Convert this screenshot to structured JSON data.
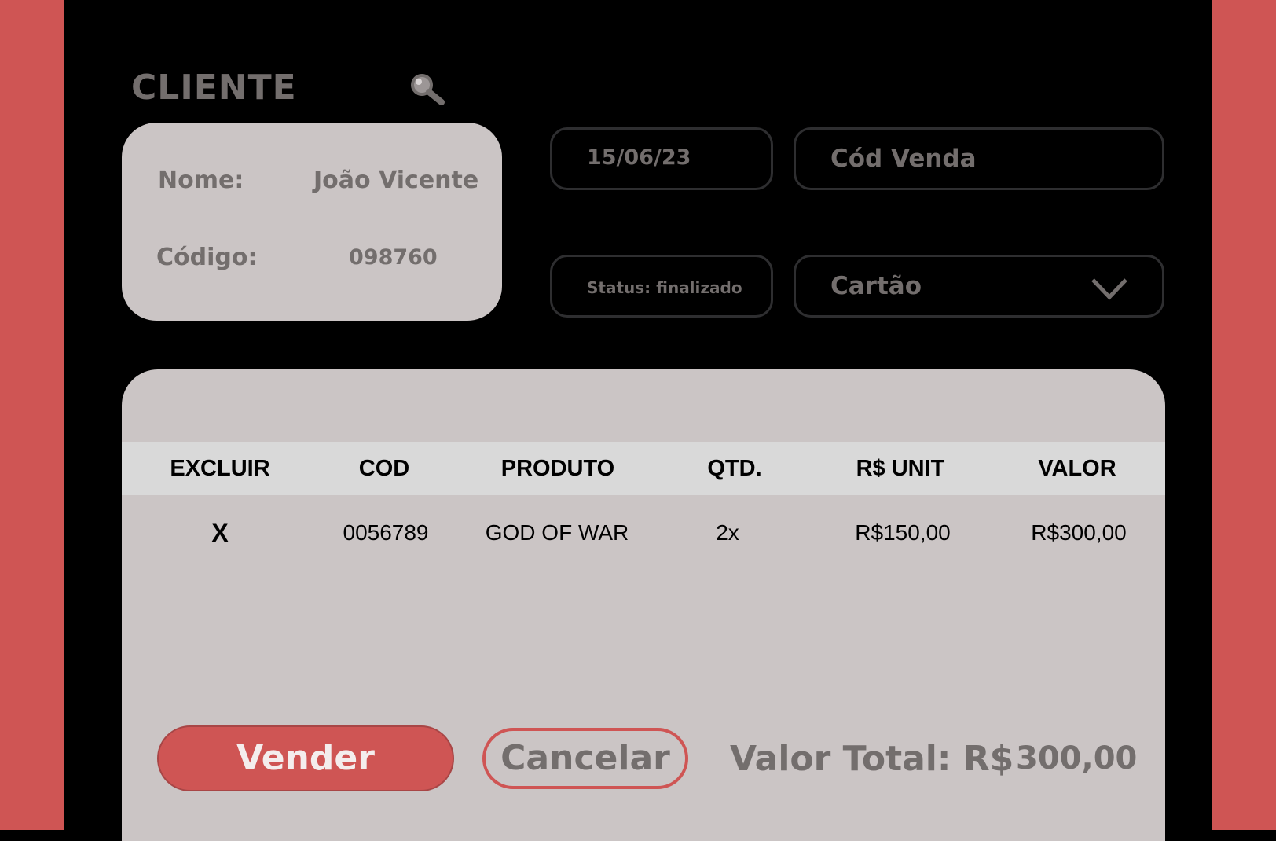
{
  "colors": {
    "accent": "#cf5554",
    "panel": "#cbc5c5",
    "muted_text": "#736e6d",
    "background": "#000000"
  },
  "cliente": {
    "title": "CLIENTE",
    "search_icon": "search-icon",
    "nome_label": "Nome:",
    "nome_value": "João Vicente",
    "codigo_label": "Código:",
    "codigo_value": "098760"
  },
  "fields": {
    "date": "15/06/23",
    "cod_venda_placeholder": "Cód Venda",
    "status": "Status: finalizado",
    "payment_method": "Cartão",
    "payment_icon": "chevron-down-icon"
  },
  "table": {
    "headers": [
      "EXCLUIR",
      "COD",
      "PRODUTO",
      "QTD.",
      "R$ UNIT",
      "VALOR"
    ],
    "rows": [
      {
        "excluir": "X",
        "cod": "0056789",
        "produto": "GOD OF WAR",
        "qtd": "2x",
        "unit": "R$150,00",
        "valor": "R$300,00"
      }
    ]
  },
  "footer": {
    "vender_label": "Vender",
    "cancelar_label": "Cancelar",
    "total_label": "Valor Total: R$",
    "total_value": "300,00"
  }
}
